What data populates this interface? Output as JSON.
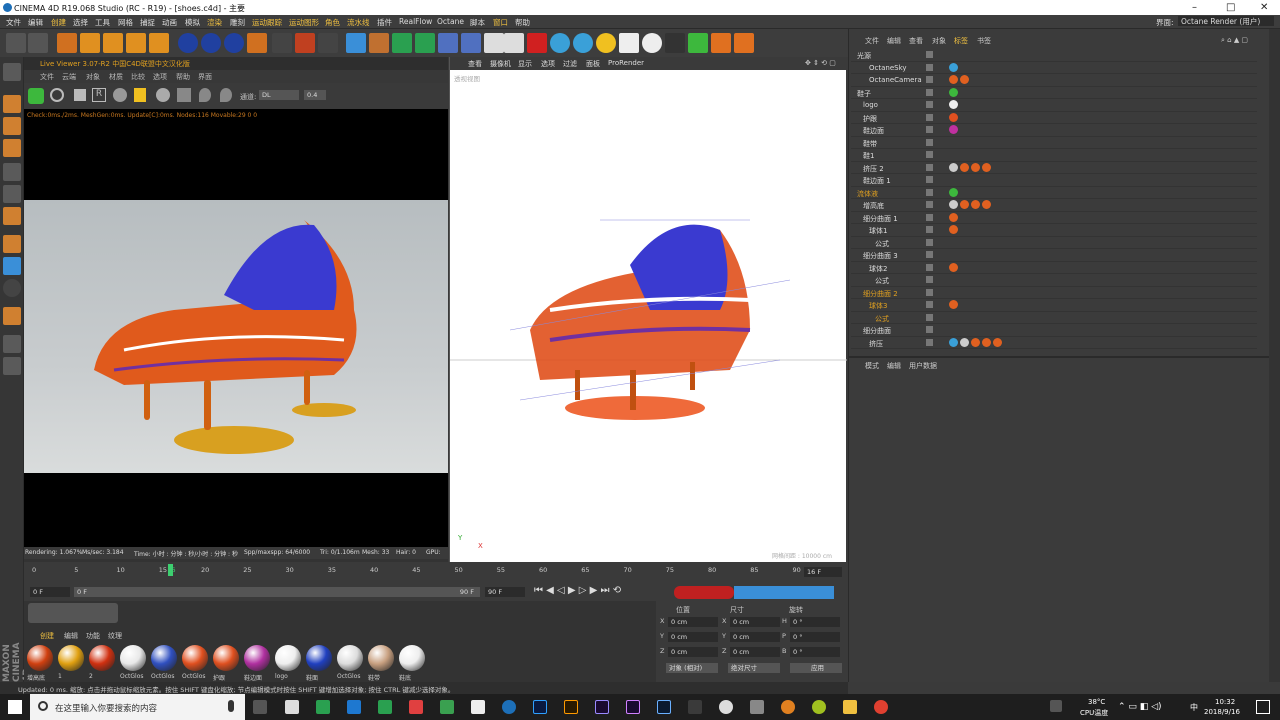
{
  "window": {
    "title": "CINEMA 4D R19.068 Studio (RC - R19) - [shoes.c4d] - 主要",
    "layout_label": "界面:",
    "layout_value": "Octane Render (用户)"
  },
  "menu": [
    "文件",
    "编辑",
    "创建",
    "选择",
    "工具",
    "网格",
    "捕捉",
    "动画",
    "模拟",
    "渲染",
    "雕刻",
    "运动跟踪",
    "运动图形",
    "角色",
    "流水线",
    "插件",
    "RealFlow",
    "Octane",
    "脚本",
    "窗口",
    "帮助"
  ],
  "live_viewer": {
    "title": "Live Viewer 3.07-R2 中国C4D联盟中文汉化版",
    "menu": [
      "文件",
      "云端",
      "对象",
      "材质",
      "比较",
      "选项",
      "帮助",
      "界面"
    ],
    "channel_label": "通道:",
    "channel_value": "DL",
    "value": "0.4",
    "status": "Check:0ms./2ms. MeshGen:0ms. Update[C]:0ms. Nodes:116 Movable:29 0 0",
    "footer": {
      "rendering": "Rendering: 1.067%",
      "ms": "Ms/sec: 3.184",
      "time": "Time: 小时 : 分钟 : 秒/小时 : 分钟 : 秒",
      "spp": "Spp/maxspp: 64/6000",
      "tri": "Tri: 0/1.106m",
      "mesh": "Mesh: 33",
      "hair": "Hair: 0",
      "gpu": "GPU:"
    }
  },
  "viewport": {
    "menu": [
      "查看",
      "摄像机",
      "显示",
      "选项",
      "过滤",
      "面板",
      "ProRender"
    ],
    "corner_label": "透视视图",
    "grid_label": "网格间距 : 10000 cm"
  },
  "object_manager": {
    "tabs": [
      "文件",
      "编辑",
      "查看",
      "对象",
      "标签",
      "书签"
    ],
    "rows": [
      {
        "name": "光源",
        "tags": []
      },
      {
        "name": "OctaneSky",
        "tags": [
          "#3aa0d8"
        ]
      },
      {
        "name": "OctaneCamera",
        "tags": [
          "#e06020",
          "#e06020"
        ]
      },
      {
        "name": "鞋子",
        "tags": [
          "#3db83d"
        ]
      },
      {
        "name": "logo",
        "tags": [
          "#eeeeee"
        ]
      },
      {
        "name": "护跟",
        "tags": [
          "#e05020"
        ]
      },
      {
        "name": "鞋边面",
        "tags": [
          "#c030a0"
        ]
      },
      {
        "name": "鞋带",
        "tags": []
      },
      {
        "name": "鞋1",
        "tags": []
      },
      {
        "name": "挤压 2",
        "tags": [
          "#cccccc",
          "#e06020",
          "#e06020",
          "#e06020"
        ]
      },
      {
        "name": "鞋边面 1",
        "tags": []
      },
      {
        "name": "流体液",
        "tags": [
          "#3db83d"
        ]
      },
      {
        "name": "增高底",
        "tags": [
          "#cccccc",
          "#e06020",
          "#e06020",
          "#e06020"
        ]
      },
      {
        "name": "细分曲面 1",
        "tags": [
          "#e06020"
        ]
      },
      {
        "name": "球体1",
        "tags": [
          "#e06020"
        ]
      },
      {
        "name": "公式",
        "tags": []
      },
      {
        "name": "细分曲面 3",
        "tags": []
      },
      {
        "name": "球体2",
        "tags": [
          "#e06020"
        ]
      },
      {
        "name": "公式",
        "tags": []
      },
      {
        "name": "细分曲面 2",
        "tags": []
      },
      {
        "name": "球体3",
        "tags": [
          "#e06020"
        ]
      },
      {
        "name": "公式",
        "tags": []
      },
      {
        "name": "细分曲面",
        "tags": []
      },
      {
        "name": "挤压",
        "tags": [
          "#3aa0d8",
          "#cccccc",
          "#e06020",
          "#e06020",
          "#e06020"
        ]
      }
    ]
  },
  "attributes": {
    "tabs": [
      "模式",
      "编辑",
      "用户数据"
    ]
  },
  "timeline": {
    "ticks": [
      "0",
      "5",
      "10",
      "15",
      "16",
      "20",
      "25",
      "30",
      "35",
      "40",
      "45",
      "50",
      "55",
      "60",
      "65",
      "70",
      "75",
      "80",
      "85",
      "90"
    ],
    "end_field": "16 F",
    "start_field": "0 F",
    "range_start": "0 F",
    "range_end": "90 F",
    "max_field": "90 F"
  },
  "materials": {
    "tabs": [
      "创建",
      "编辑",
      "功能",
      "纹理"
    ],
    "items": [
      {
        "label": "增高底",
        "color": "#d04010"
      },
      {
        "label": "1",
        "color": "#e0a010"
      },
      {
        "label": "2",
        "color": "#d03010"
      },
      {
        "label": "OctGlos",
        "color": "#e8e8e8"
      },
      {
        "label": "OctGlos",
        "color": "#3050c0"
      },
      {
        "label": "OctGlos",
        "color": "#e05020"
      },
      {
        "label": "护跟",
        "color": "#e05020"
      },
      {
        "label": "鞋边面",
        "color": "#b030a0"
      },
      {
        "label": "logo",
        "color": "#eeeeee"
      },
      {
        "label": "鞋面",
        "color": "#2040c0"
      },
      {
        "label": "OctGlos",
        "color": "#dddddd"
      },
      {
        "label": "鞋带",
        "color": "#c8a080"
      },
      {
        "label": "鞋底",
        "color": "#eeeeee"
      }
    ]
  },
  "coords": {
    "headers": [
      "位置",
      "尺寸",
      "旋转"
    ],
    "rows": [
      [
        "X",
        "0 cm",
        "X",
        "0 cm",
        "H",
        "0 °"
      ],
      [
        "Y",
        "0 cm",
        "Y",
        "0 cm",
        "P",
        "0 °"
      ],
      [
        "Z",
        "0 cm",
        "Z",
        "0 cm",
        "B",
        "0 °"
      ]
    ],
    "mode": "对象 (相对)",
    "size_mode": "绝对尺寸",
    "apply": "应用"
  },
  "statusbar": "Updated: 0 ms.  缩放: 点击并拖动鼠标缩放元素。按住 SHIFT 键盘化缩放; 节点编辑模式时按住 SHIFT 键增加选择对象; 按住 CTRL 键减少选择对象。",
  "taskbar": {
    "search": "在这里输入你要搜索的内容",
    "temp": "38°C",
    "temp_label": "CPU温度",
    "time": "10:32",
    "date": "2018/9/16",
    "lang": "中"
  }
}
